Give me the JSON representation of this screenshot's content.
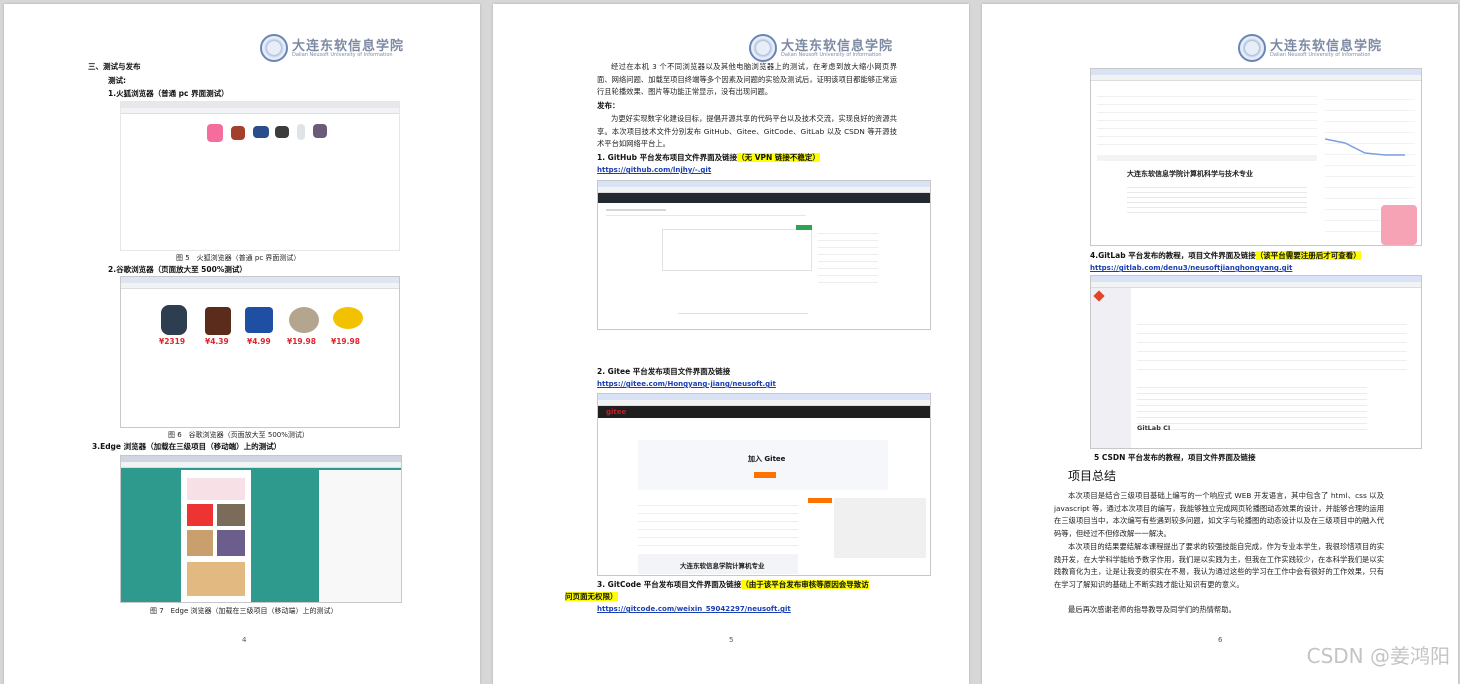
{
  "logo": {
    "cn": "大连东软信息学院",
    "en": "Dalian Neusoft University of Information"
  },
  "page4": {
    "page_number": "4",
    "section": "三、测试与发布",
    "test_label": "测试:",
    "h1": "1.火狐浏览器（普通 pc 界面测试）",
    "fig5": "图 5　火狐浏览器（普通 pc 界面测试）",
    "h2": "2.谷歌浏览器（页面放大至 500%测试）",
    "prices": [
      "¥2319",
      "¥4.39",
      "¥4.99",
      "¥19.98",
      "¥19.98"
    ],
    "fig6": "图 6　谷歌浏览器（页面放大至 500%测试）",
    "h3": "3.Edge 浏览器（加载在三级项目（移动端）上的测试）",
    "fig7": "图 7　Edge 浏览器（加载在三级项目（移动端）上的测试）"
  },
  "page5": {
    "page_number": "5",
    "para1": "经过在本机 3 个不同浏览器以及其他电脑浏览器上的测试，在考虑到放大缩小网页界面、网络问题、加载至项目终端等多个因素及问题的实验及测试后，证明该项目都能够正常运行且轮播效果、图片等功能正常显示，没有出现问题。",
    "publish_label": "发布：",
    "para2": "为更好实现数字化建设目标，提倡开源共享的代码平台以及技术交流，实现良好的资源共享。本次项目技术文件分别发布 GitHub、Gitee、GitCode、GitLab 以及 CSDN 等开源技术平台如网络平台上。",
    "g1": "1. GitHub 平台发布项目文件界面及链接",
    "g1_note": "（无 VPN 链接不稳定）",
    "g1_link": "https://github.com/lnjhy/-.git",
    "g2": "2. Gitee 平台发布项目文件界面及链接",
    "g2_link": "https://gitee.com/Hongyang-jiang/neusoft.git",
    "gitee_banner": "大连东软信息学院计算机专业",
    "gitee_join": "加入 Gitee",
    "g3": "3. GitCode 平台发布项目文件界面及链接",
    "g3_note_a": "（由于该平台发布审核等原因会导致访",
    "g3_note_b": "问页面无权限）",
    "g3_link": "https://gitcode.com/weixin_59042297/neusoft.git"
  },
  "page6": {
    "page_number": "6",
    "repo_title": "大连东软信息学院计算机科学与技术专业",
    "g4": "4.GitLab 平台发布的教程，项目文件界面及链接",
    "g4_note": "（该平台需要注册后才可查看）",
    "g4_link": "https://gitlab.com/denu3/neusoftjianghongyang.git",
    "g5": "5 CSDN 平台发布的教程，项目文件界面及链接",
    "summary_title": "项目总结",
    "s1": "本次项目是结合三级项目基础上编写的一个响应式 WEB 开发语言，其中包含了 html、css 以及 javascript 等，通过本次项目的编写，我能够独立完成网页轮播图动态效果的设计，并能够合理的运用在三级项目当中，本次编写有些遇到较多问题，如文字与轮播图的动态设计以及在三级项目中的融入代码等，但经过不但修改解一一解决。",
    "s2": "本次项目的结果要结解本课程提出了要求的较强技能自完成，作为专业本学生，我很珍惜项目的实践开发，在大学科学能给予数字作用，我们是以实践为主，但我在工作实践较少，在本科学我们是以实践教育化为主，让是让我变的很实在不易，我认为通过这些的学习在工作中会有很好的工作效果，只有在学习了解知识的基础上不断实践才能让知识有更的意义。",
    "s3": "最后再次感谢老师的指导教导及同学们的热情帮助。"
  },
  "watermark": "CSDN @姜鸿阳",
  "colors": {
    "link": "#1a3fb3",
    "highlight": "#ffff00",
    "price": "#e0262d",
    "page_bg": "#d7d7d7"
  }
}
